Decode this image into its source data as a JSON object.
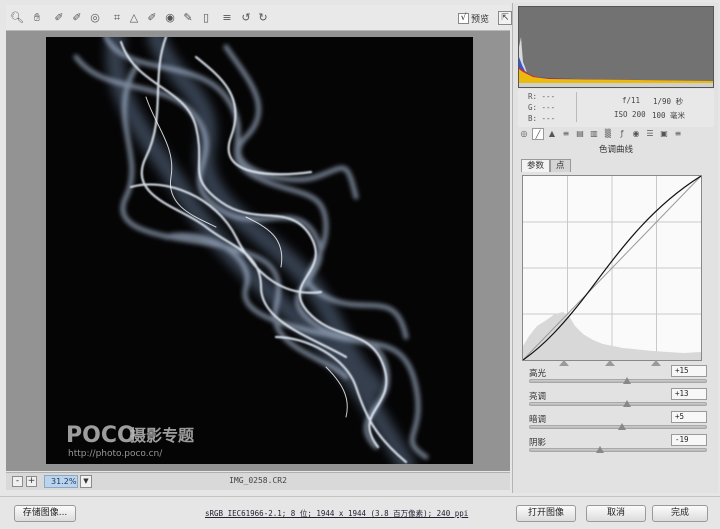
{
  "toolbar": {
    "tools": [
      "zoom-icon",
      "hand-icon",
      "white-balance-icon",
      "color-sampler-icon",
      "target-adjust-icon",
      "crop-icon",
      "straighten-icon",
      "spot-removal-icon",
      "red-eye-icon",
      "adjustment-brush-icon",
      "graduated-filter-icon",
      "preferences-icon",
      "rotate-ccw-icon",
      "rotate-cw-icon"
    ],
    "preview_checked": "√",
    "preview_label": "预览"
  },
  "image": {
    "watermark_brand": "POCO",
    "watermark_title": "摄影专题",
    "watermark_url": "http://photo.poco.cn/"
  },
  "statusbar": {
    "zoom": "31.2%",
    "filename": "IMG_0258.CR2"
  },
  "info": {
    "r_label": "R:",
    "r_value": "---",
    "g_label": "G:",
    "g_value": "---",
    "b_label": "B:",
    "b_value": "---",
    "aperture": "f/11",
    "shutter": "1/90 秒",
    "iso": "ISO 200",
    "focal": "100 毫米"
  },
  "panel": {
    "title": "色调曲线",
    "tab_params": "参数",
    "tab_point": "点"
  },
  "sliders": [
    {
      "label": "高光",
      "value": "+15",
      "level": 0.55
    },
    {
      "label": "亮调",
      "value": "+13",
      "level": 0.55
    },
    {
      "label": "暗调",
      "value": "+5",
      "level": 0.52
    },
    {
      "label": "阴影",
      "value": "-19",
      "level": 0.4
    }
  ],
  "footer": {
    "save_label": "存储图像...",
    "meta_link": "sRGB IEC61966-2.1; 8 位; 1944 x 1944 (3.8 百万像素); 240 ppi",
    "open_label": "打开图像",
    "cancel_label": "取消",
    "done_label": "完成"
  },
  "colors": {
    "zoom_highlight": "#bcd3ec",
    "canvas_bg": "#939393",
    "histogram_bg": "#727272"
  }
}
